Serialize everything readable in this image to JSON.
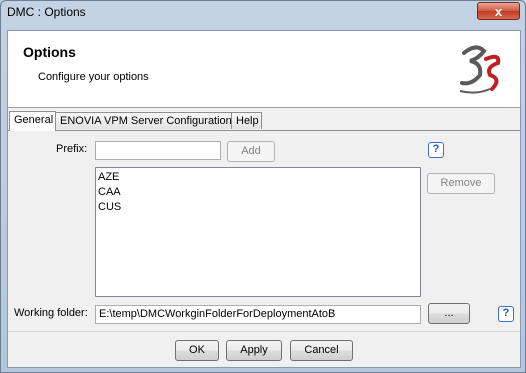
{
  "window": {
    "title": "DMC : Options",
    "close_glyph": "x"
  },
  "header": {
    "title": "Options",
    "subtitle": "Configure your options",
    "logo_icon": "3ds-logo-icon"
  },
  "tabs": [
    {
      "label": "General",
      "active": true
    },
    {
      "label": "ENOVIA VPM Server Configuration",
      "active": false
    },
    {
      "label": "Help",
      "active": false
    }
  ],
  "general": {
    "prefix_label": "Prefix:",
    "prefix_value": "",
    "add_label": "Add",
    "remove_label": "Remove",
    "prefixes": [
      "AZE",
      "CAA",
      "CUS"
    ],
    "working_folder_label": "Working folder:",
    "working_folder_value": "E:\\temp\\DMCWorkginFolderForDeploymentAtoB",
    "browse_label": "...",
    "help_glyph": "?"
  },
  "footer": {
    "ok_label": "OK",
    "apply_label": "Apply",
    "cancel_label": "Cancel"
  },
  "colors": {
    "header_bg": "#ffffff",
    "help_icon": "#1f5cb8",
    "close_button": "#c9452d"
  }
}
